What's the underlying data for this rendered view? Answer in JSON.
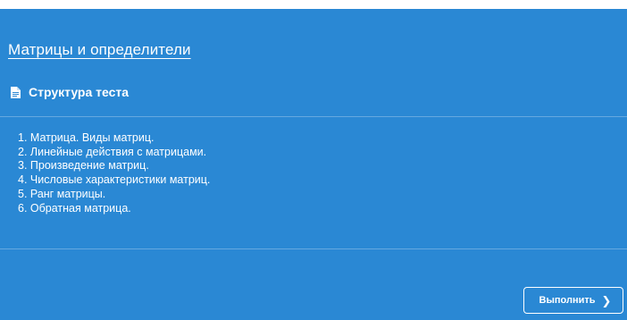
{
  "test": {
    "title": "Матрицы и определители",
    "section_label": "Структура теста",
    "topics": [
      "1. Матрица. Виды матриц.",
      "2. Линейные действия с матрицами.",
      "3. Произведение матриц.",
      "4. Числовые характеристики матриц.",
      "5. Ранг матрицы.",
      "6. Обратная матрица."
    ],
    "run_label": "Выполнить",
    "run_icon": "chevron-right-icon",
    "section_icon": "document-icon"
  },
  "colors": {
    "background": "#2a88d4",
    "text": "#ffffff"
  }
}
